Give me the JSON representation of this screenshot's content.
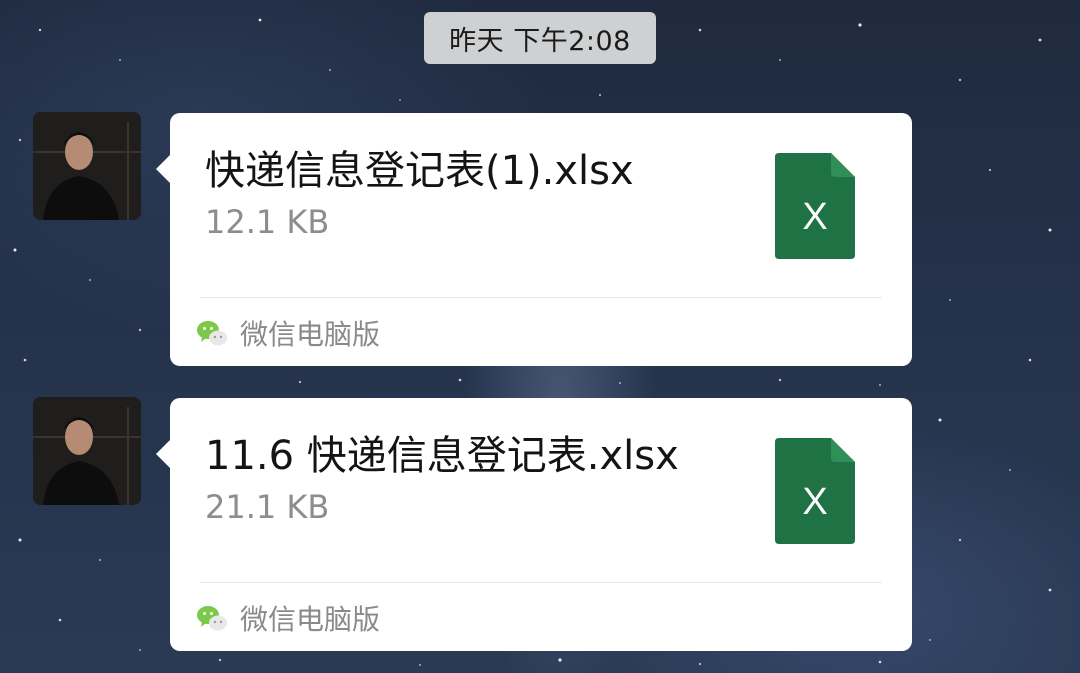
{
  "chat": {
    "timestamp": "昨天 下午2:08",
    "messages": [
      {
        "file_name": "快递信息登记表(1).xlsx",
        "file_size": "12.1 KB",
        "file_icon": "excel-icon",
        "file_icon_letter": "X",
        "source_icon": "wechat-icon",
        "source_label": "微信电脑版"
      },
      {
        "file_name": "11.6 快递信息登记表.xlsx",
        "file_size": "21.1 KB",
        "file_icon": "excel-icon",
        "file_icon_letter": "X",
        "source_icon": "wechat-icon",
        "source_label": "微信电脑版"
      }
    ]
  },
  "colors": {
    "excel_green": "#1f7244",
    "excel_fold": "#2f8f57",
    "wechat_green": "#7bc84a",
    "bubble_bg": "#ffffff"
  }
}
